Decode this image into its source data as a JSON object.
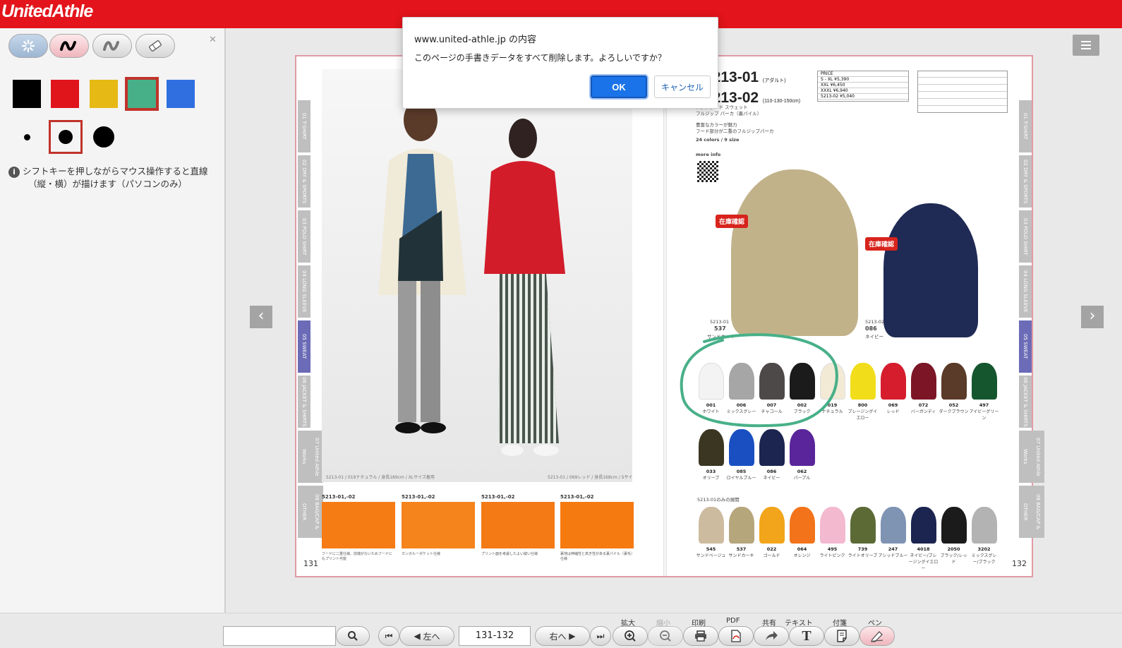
{
  "header": {
    "logo_text": "UnitedAthle",
    "bg_color": "#e3141b"
  },
  "tools": {
    "buttons": [
      {
        "name": "spinner-tool-icon",
        "active": true
      },
      {
        "name": "pen-tool-icon",
        "active": false
      },
      {
        "name": "marker-tool-icon",
        "active": false
      },
      {
        "name": "eraser-tool-icon",
        "active": false
      }
    ],
    "colors": [
      "#000000",
      "#e0141b",
      "#e6b914",
      "#48b088",
      "#2f6fe0"
    ],
    "selected_color": "#48b088",
    "hint_line1": "シフトキーを押しながらマウス操作すると直線",
    "hint_line2": "（縦・横）が描けます（パソコンのみ）"
  },
  "dialog": {
    "host": "www.united-athle.jp の内容",
    "message": "このページの手書きデータをすべて削除します。よろしいですか？",
    "ok": "OK",
    "cancel": "キャンセル"
  },
  "book": {
    "left_tabs": [
      "01 T-SHIRT",
      "02 DRY & SPORTS",
      "03 POLO SHIRT",
      "04 LONG SLEEVE",
      "05 SWEAT",
      "06 JACKET & SHIRTS",
      "07 United Athle Works",
      "08 BAG/CAP & OTHER"
    ],
    "active_tab": "05 SWEAT",
    "left_page": "131",
    "right_page": "132",
    "photo_caption_left": "5213-01 / 019ナチュラル / 身長189cm / XLサイズ着用",
    "photo_caption_right": "5213-01 / 069レッド / 身長168cm / Sサイズ着用",
    "detail_thumbs": [
      {
        "code": "5213-01,-02",
        "caption": "フードに二重仕様。前端がないためフードにもプリント可能"
      },
      {
        "code": "5213-01,-02",
        "caption": "カンガルーポケット仕様"
      },
      {
        "code": "5213-01,-02",
        "caption": "プリント面を考慮したよい縫い仕様"
      },
      {
        "code": "5213-01,-02",
        "caption": "裏地は伸縮性と高き性がある裏パイル（裏毛）仕様"
      }
    ],
    "product": {
      "code1": "5213-01",
      "code1_note": "(アダルト)",
      "code2": "5213-02",
      "code2_note": "(110-130-150cm)",
      "name1": "スタンダード スウェット",
      "name2": "フルジップ パーカ（裏パイル）",
      "desc1": "豊富なカラーが魅力",
      "desc2": "フード部分が二重のフルジップパーカ",
      "colors_sizes": "24 colors / 9 size",
      "more_info": "more info",
      "price_header": "PRICE",
      "prices": [
        "S - XL ¥5,390",
        "XXL ¥6,450",
        "XXXL ¥6,940",
        "5213-02 ¥5,040"
      ],
      "stock_badge": "在庫確認"
    },
    "featured": [
      {
        "code": "5213-01",
        "num": "537",
        "name": "サンドカーキ",
        "color": "#c2b28a"
      },
      {
        "code": "5213-02",
        "num": "086",
        "name": "ネイビー",
        "color": "#1f2a55"
      }
    ],
    "swatches_row1": [
      {
        "num": "001",
        "name": "ホワイト",
        "color": "#f3f3f3"
      },
      {
        "num": "006",
        "name": "ミックスグレー",
        "color": "#a6a6a6"
      },
      {
        "num": "007",
        "name": "チャコール",
        "color": "#4d4948"
      },
      {
        "num": "002",
        "name": "ブラック",
        "color": "#1b1b1b"
      },
      {
        "num": "019",
        "name": "ナチュラル",
        "color": "#f3ead6"
      },
      {
        "num": "800",
        "name": "ブレージングイエロー",
        "color": "#f1dd1a"
      },
      {
        "num": "069",
        "name": "レッド",
        "color": "#d51d2d"
      },
      {
        "num": "072",
        "name": "バーガンディ",
        "color": "#7c1626"
      },
      {
        "num": "052",
        "name": "ダークブラウン",
        "color": "#5a3a28"
      },
      {
        "num": "497",
        "name": "アイビーグリーン",
        "color": "#15562f"
      }
    ],
    "swatches_row2": [
      {
        "num": "033",
        "name": "オリーブ",
        "color": "#3a3621"
      },
      {
        "num": "085",
        "name": "ロイヤルブルー",
        "color": "#1a4fc2"
      },
      {
        "num": "086",
        "name": "ネイビー",
        "color": "#1c2550"
      },
      {
        "num": "062",
        "name": "パープル",
        "color": "#5a259a"
      }
    ],
    "only_label": "5213-01のみの展開",
    "swatches_row3": [
      {
        "num": "545",
        "name": "サンドベージュ",
        "color": "#cdbb9f"
      },
      {
        "num": "537",
        "name": "サンドカーキ",
        "color": "#b6a67c"
      },
      {
        "num": "022",
        "name": "ゴールド",
        "color": "#f2a51a"
      },
      {
        "num": "064",
        "name": "オレンジ",
        "color": "#f2731a"
      },
      {
        "num": "495",
        "name": "ライトピンク",
        "color": "#f3b9cf"
      },
      {
        "num": "739",
        "name": "ライトオリーブ",
        "color": "#5c6a36"
      },
      {
        "num": "247",
        "name": "アシッドブルー",
        "color": "#7f93b3"
      },
      {
        "num": "4018",
        "name": "ネイビー/ブレージングイエロー",
        "color": "#1c2550"
      },
      {
        "num": "2050",
        "name": "ブラック/レッド",
        "color": "#1b1b1b"
      },
      {
        "num": "3202",
        "name": "ミックスグレー/ブラック",
        "color": "#b3b3b3"
      }
    ]
  },
  "bottom": {
    "labels": {
      "zoom_in": "拡大",
      "zoom_out": "縮小",
      "print": "印刷",
      "pdf": "PDF",
      "share": "共有",
      "text": "テキスト",
      "sticky": "付箋",
      "pen": "ペン"
    },
    "prev_label": "左へ",
    "next_label": "右へ",
    "page_value": "131-132",
    "search_value": ""
  }
}
